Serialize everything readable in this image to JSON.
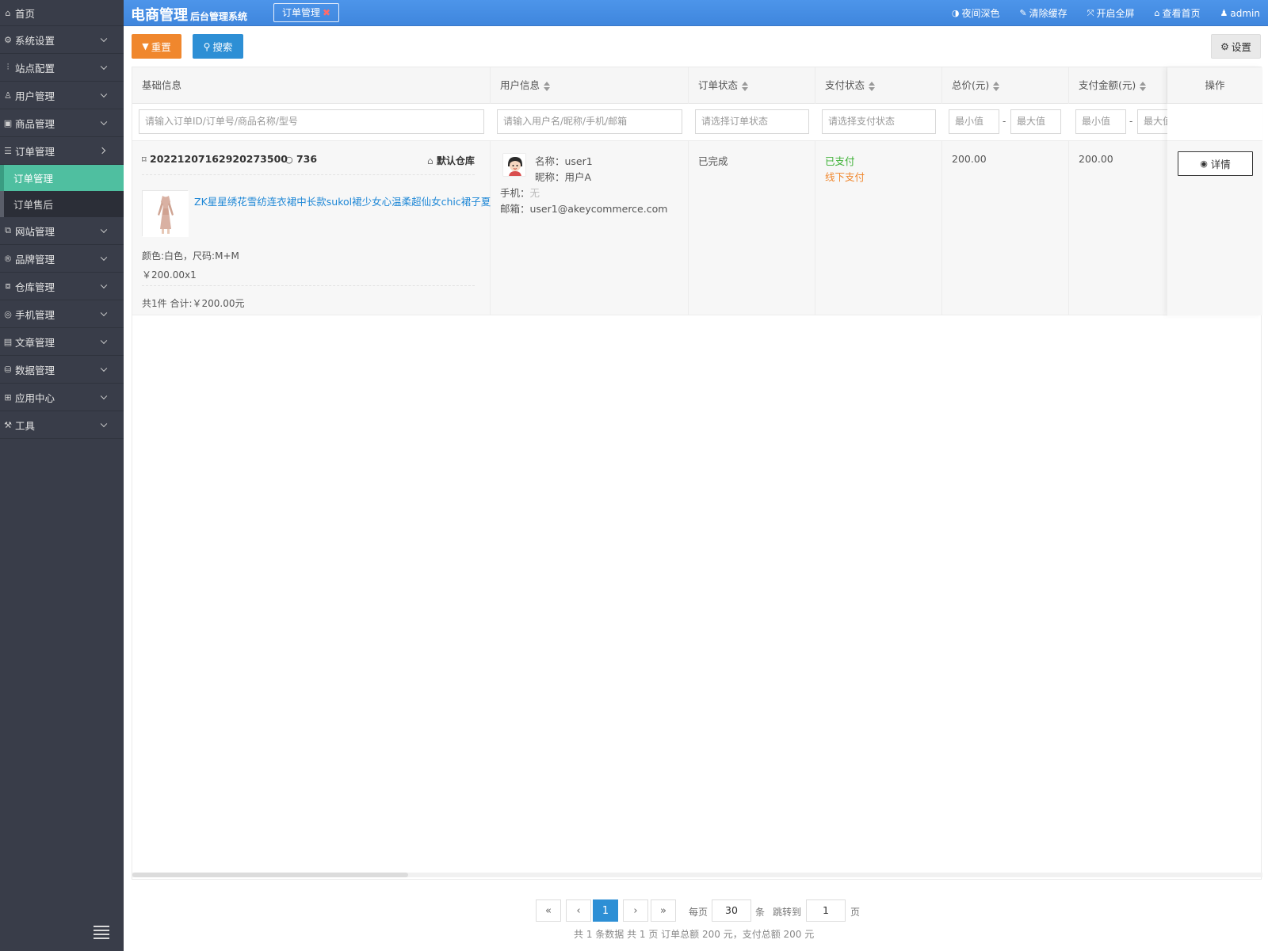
{
  "header": {
    "brand_main": "电商管理",
    "brand_sub": "后台管理系统",
    "open_tab": "订单管理",
    "nav": [
      {
        "icon": "half-circle-icon",
        "glyph": "◑",
        "label": "夜间深色"
      },
      {
        "icon": "brush-icon",
        "glyph": "✎",
        "label": "清除缓存"
      },
      {
        "icon": "fullscreen-icon",
        "glyph": "⤧",
        "label": "开启全屏"
      },
      {
        "icon": "home-icon",
        "glyph": "⌂",
        "label": "查看首页"
      },
      {
        "icon": "user-icon",
        "glyph": "♟",
        "label": "admin"
      }
    ]
  },
  "sidebar": {
    "items": [
      {
        "label": "首页",
        "glyph": "⌂"
      },
      {
        "label": "系统设置",
        "glyph": "⚙"
      },
      {
        "label": "站点配置",
        "glyph": "⫶"
      },
      {
        "label": "用户管理",
        "glyph": "♙"
      },
      {
        "label": "商品管理",
        "glyph": "▣"
      },
      {
        "label": "订单管理",
        "glyph": "☰"
      },
      {
        "label": "网站管理",
        "glyph": "⧉"
      },
      {
        "label": "品牌管理",
        "glyph": "®"
      },
      {
        "label": "仓库管理",
        "glyph": "⧈"
      },
      {
        "label": "手机管理",
        "glyph": "◎"
      },
      {
        "label": "文章管理",
        "glyph": "▤"
      },
      {
        "label": "数据管理",
        "glyph": "⛁"
      },
      {
        "label": "应用中心",
        "glyph": "⊞"
      },
      {
        "label": "工具",
        "glyph": "⚒"
      }
    ],
    "sub_items": [
      "订单管理",
      "订单售后"
    ]
  },
  "toolbar": {
    "reset_label": "重置",
    "search_label": "搜索",
    "settings_label": "设置"
  },
  "table": {
    "columns": [
      "基础信息",
      "用户信息",
      "订单状态",
      "支付状态",
      "总价(元)",
      "支付金额(元)",
      "操作"
    ],
    "filters": {
      "basic_placeholder": "请输入订单ID/订单号/商品名称/型号",
      "user_placeholder": "请输入用户名/昵称/手机/邮箱",
      "order_status_placeholder": "请选择订单状态",
      "pay_status_placeholder": "请选择支付状态",
      "min_placeholder": "最小值",
      "max_placeholder": "最大值",
      "pay_max_placeholder": "最大值"
    },
    "rows": [
      {
        "order_no": "20221207162920273500",
        "order_count": "736",
        "warehouse": "默认仓库",
        "product_name": "ZK星星绣花雪纺连衣裙中长款sukol裙少女心温柔超仙女chic裙子夏",
        "spec": "颜色:白色，尺码:M+M",
        "price": "￥200.00x1",
        "total_line": "共1件 合计:￥200.00元",
        "user_name": "名称：user1",
        "user_nick": "昵称：用户A",
        "user_phone_label": "手机：",
        "user_phone": "无",
        "user_email": "邮箱：user1@akeycommerce.com",
        "order_status": "已完成",
        "pay_status": "已支付",
        "pay_method": "线下支付",
        "total_price": "200.00",
        "pay_amount": "200.00",
        "action": "详情"
      }
    ]
  },
  "pagination": {
    "first": "«",
    "prev": "‹",
    "current": "1",
    "next": "›",
    "last": "»",
    "per_page_label": "每页",
    "per_page_value": "30",
    "per_page_unit": "条",
    "jump_label": "跳转到",
    "jump_value": "1",
    "jump_unit": "页",
    "summary": "共 1 条数据   共 1 页   订单总额 200 元，支付总额 200 元"
  },
  "colors": {
    "header_bg": "#4a90e2",
    "sidebar_bg": "#393d49",
    "active_green": "#4fbfa0",
    "reset_orange": "#f0872d",
    "search_blue": "#2d8fd5",
    "paid_green": "#3cb034",
    "offline_orange": "#f0872d",
    "link_blue": "#1e87d6"
  }
}
